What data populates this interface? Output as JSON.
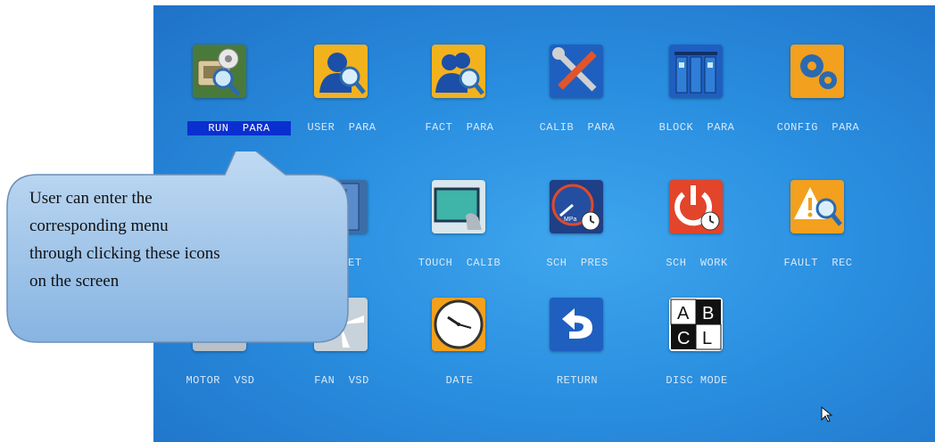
{
  "menu": {
    "items": [
      {
        "id": "run-para",
        "label": "RUN  PARA",
        "selected": true,
        "icon": "run-para-icon"
      },
      {
        "id": "user-para",
        "label": "USER  PARA",
        "selected": false,
        "icon": "user-para-icon"
      },
      {
        "id": "fact-para",
        "label": "FACT  PARA",
        "selected": false,
        "icon": "fact-para-icon"
      },
      {
        "id": "calib-para",
        "label": "CALIB  PARA",
        "selected": false,
        "icon": "calib-para-icon"
      },
      {
        "id": "block-para",
        "label": "BLOCK  PARA",
        "selected": false,
        "icon": "block-para-icon"
      },
      {
        "id": "config-para",
        "label": "CONFIG  PARA",
        "selected": false,
        "icon": "config-para-icon"
      },
      {
        "id": "set",
        "label": "SET",
        "selected": false,
        "icon": "set-icon"
      },
      {
        "id": "touch-calib",
        "label": "TOUCH  CALIB",
        "selected": false,
        "icon": "touch-calib-icon"
      },
      {
        "id": "sch-pres",
        "label": "SCH  PRES",
        "selected": false,
        "icon": "sch-pres-icon"
      },
      {
        "id": "sch-work",
        "label": "SCH  WORK",
        "selected": false,
        "icon": "sch-work-icon"
      },
      {
        "id": "fault-rec",
        "label": "FAULT  REC",
        "selected": false,
        "icon": "fault-rec-icon"
      },
      {
        "id": "motor-vsd",
        "label": "MOTOR  VSD",
        "selected": false,
        "icon": "motor-vsd-icon"
      },
      {
        "id": "fan-vsd",
        "label": "FAN  VSD",
        "selected": false,
        "icon": "fan-vsd-icon"
      },
      {
        "id": "date",
        "label": "DATE",
        "selected": false,
        "icon": "clock-icon"
      },
      {
        "id": "return",
        "label": "RETURN",
        "selected": false,
        "icon": "return-icon"
      },
      {
        "id": "disc-mode",
        "label": "DISC MODE",
        "selected": false,
        "icon": "disc-mode-icon"
      }
    ]
  },
  "disc_icon_letters": [
    "A",
    "B",
    "C",
    "L"
  ],
  "gauge_unit": "MPa",
  "callout": {
    "lines": [
      "User can enter the",
      "corresponding menu",
      "through clicking these icons",
      "on the screen"
    ]
  },
  "colors": {
    "screen_bg": "#2a8fe0",
    "selected_label_bg": "#0a2fd0",
    "callout_fill": "#9fc6ea"
  }
}
